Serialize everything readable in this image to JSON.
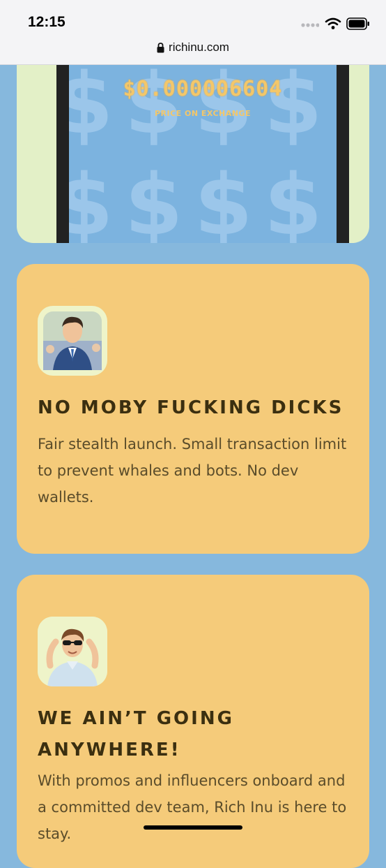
{
  "status_bar": {
    "time": "12:15"
  },
  "browser": {
    "url": "richinu.com"
  },
  "price_widget": {
    "price": "$0.000006604",
    "label": "PRICE ON EXCHANGE"
  },
  "features": [
    {
      "title": "NO MOBY FUCKING DICKS",
      "text": "Fair stealth launch. Small transaction limit to prevent whales and bots. No dev wallets."
    },
    {
      "title": "WE AIN’T GOING ANYWHERE!",
      "text": "With promos and influencers onboard and a committed dev team, Rich Inu is here to stay."
    }
  ]
}
